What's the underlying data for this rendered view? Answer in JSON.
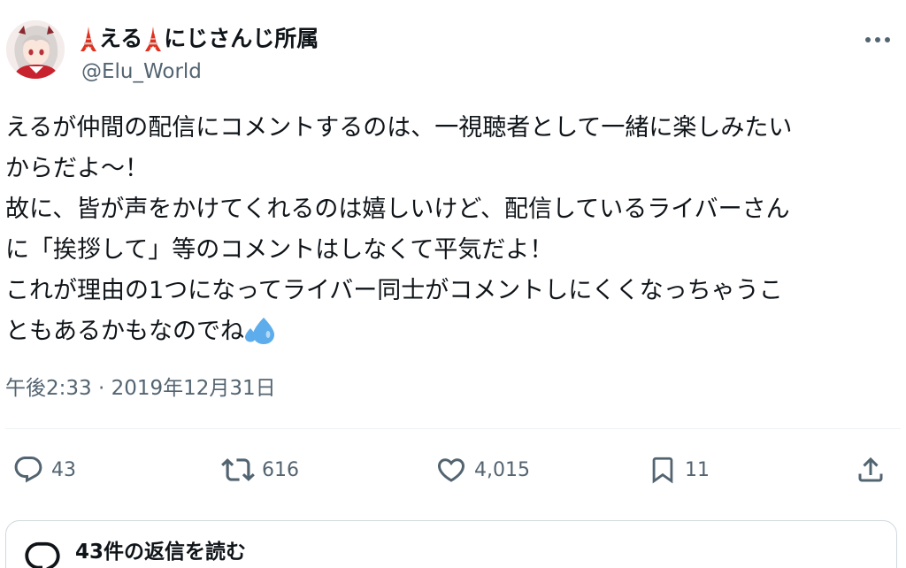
{
  "author": {
    "name_part1": "える",
    "name_part2": "にじさんじ所属",
    "handle": "@Elu_World"
  },
  "tweet": {
    "line1": "えるが仲間の配信にコメントするのは、一視聴者として一緒に楽しみたい",
    "line2": "からだよ〜！",
    "line3": "故に、皆が声をかけてくれるのは嬉しいけど、配信しているライバーさん",
    "line4": "に「挨拶して」等のコメントはしなくて平気だよ！",
    "line5": "これが理由の1つになってライバー同士がコメントしにくくなっちゃうこ",
    "line6": "ともあるかもなのでね"
  },
  "timestamp": "午後2:33 · 2019年12月31日",
  "actions": {
    "replies": "43",
    "retweets": "616",
    "likes": "4,015",
    "bookmarks": "11"
  },
  "read_replies_label": "43件の返信を読む",
  "icons": {
    "name_decoration": "tokyo-tower-icon",
    "tweet_emoji": "sweat-droplets-icon",
    "more": "more-icon",
    "reply": "reply-icon",
    "retweet": "retweet-icon",
    "like": "heart-icon",
    "bookmark": "bookmark-icon",
    "share": "share-icon"
  },
  "colors": {
    "text": "#0f1419",
    "secondary": "#536471",
    "border": "#cfd9de",
    "emoji_blue": "#5dadec",
    "tower_red": "#e0301e"
  }
}
